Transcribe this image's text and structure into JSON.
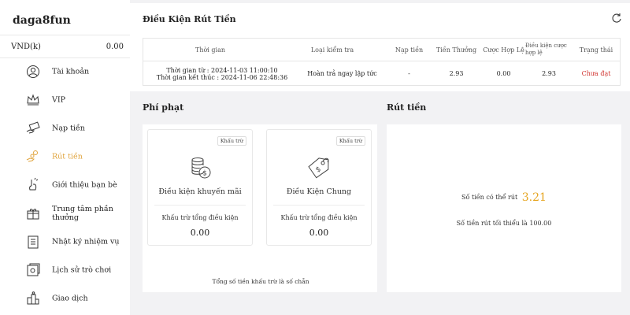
{
  "brand": "daga8fun",
  "balance": {
    "currency": "VND(k)",
    "amount": "0.00"
  },
  "nav": [
    {
      "label": "Tài khoản",
      "icon": "user-icon"
    },
    {
      "label": "VIP",
      "icon": "crown-icon"
    },
    {
      "label": "Nạp tiền",
      "icon": "deposit-hand-icon"
    },
    {
      "label": "Rút tiền",
      "icon": "withdraw-hand-icon",
      "active": true
    },
    {
      "label": "Giới thiệu bạn bè",
      "icon": "invite-hand-icon"
    },
    {
      "label": "Trung tâm phần thưởng",
      "icon": "gift-icon"
    },
    {
      "label": "Nhật ký nhiệm vụ",
      "icon": "task-log-icon"
    },
    {
      "label": "Lịch sử trò chơi",
      "icon": "game-history-icon"
    },
    {
      "label": "Giao dịch",
      "icon": "transactions-icon"
    }
  ],
  "conditions": {
    "title": "Điều Kiện Rút Tiền",
    "headers": [
      "Thời gian",
      "Loại kiểm tra",
      "Nạp tiền",
      "Tiền Thưởng",
      "Cược Hợp Lệ",
      "Điều kiện cược hợp lệ",
      "Trạng thái"
    ],
    "row": {
      "start": "Thời gian từ : 2024-11-03 11:00:10",
      "end": "Thời gian kết thúc : 2024-11-06 22:48:36",
      "check_type": "Hoàn trả ngay lập tức",
      "deposit": "-",
      "bonus": "2.93",
      "valid_bet": "0.00",
      "required_bet": "2.93",
      "status": "Chưa đạt"
    },
    "status_color": "#d0312d"
  },
  "penalty": {
    "title": "Phí phạt",
    "cards": [
      {
        "badge": "Khấu trừ",
        "name": "Điều kiện khuyến mãi",
        "sub": "Khấu trừ tổng điều kiện",
        "value": "0.00",
        "icon": "coins-icon"
      },
      {
        "badge": "Khấu trừ",
        "name": "Điều Kiện Chung",
        "sub": "Khấu trừ tổng điều kiện",
        "value": "0.00",
        "icon": "tag-icon"
      }
    ],
    "footnote": "Tổng số tiền khấu trừ là số chẵn"
  },
  "withdraw": {
    "title": "Rút tiền",
    "label": "Số tiền có thể rút",
    "amount": "3.21",
    "min_note": "Số tiền rút tối thiểu là 100.00",
    "amount_color": "#e6a521"
  }
}
